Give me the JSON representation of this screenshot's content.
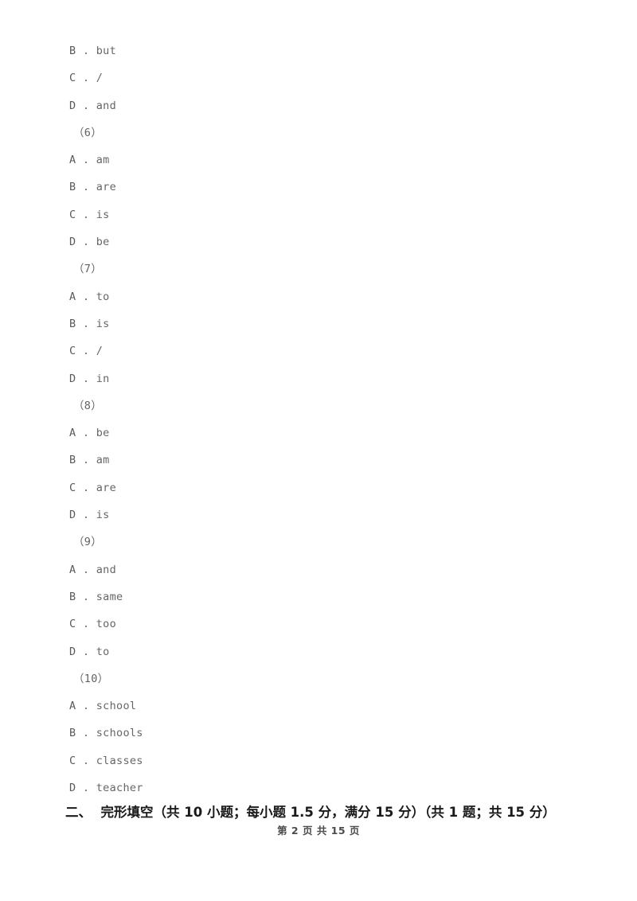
{
  "document": {
    "page_background": "#ffffff",
    "text_color": "#5f5f5f",
    "heading_color": "#1a1a1a"
  },
  "body_lines": [
    {
      "kind": "option",
      "letter": "B",
      "sep": " . ",
      "value": "but"
    },
    {
      "kind": "option",
      "letter": "C",
      "sep": " . ",
      "value": "/"
    },
    {
      "kind": "option",
      "letter": "D",
      "sep": " . ",
      "value": "and"
    },
    {
      "kind": "qnum",
      "text": "（6）"
    },
    {
      "kind": "option",
      "letter": "A",
      "sep": " . ",
      "value": "am"
    },
    {
      "kind": "option",
      "letter": "B",
      "sep": " . ",
      "value": "are"
    },
    {
      "kind": "option",
      "letter": "C",
      "sep": " . ",
      "value": "is"
    },
    {
      "kind": "option",
      "letter": "D",
      "sep": " . ",
      "value": "be"
    },
    {
      "kind": "qnum",
      "text": "（7）"
    },
    {
      "kind": "option",
      "letter": "A",
      "sep": " . ",
      "value": "to"
    },
    {
      "kind": "option",
      "letter": "B",
      "sep": " . ",
      "value": "is"
    },
    {
      "kind": "option",
      "letter": "C",
      "sep": " . ",
      "value": "/"
    },
    {
      "kind": "option",
      "letter": "D",
      "sep": " . ",
      "value": "in"
    },
    {
      "kind": "qnum",
      "text": "（8）"
    },
    {
      "kind": "option",
      "letter": "A",
      "sep": " . ",
      "value": "be"
    },
    {
      "kind": "option",
      "letter": "B",
      "sep": " . ",
      "value": "am"
    },
    {
      "kind": "option",
      "letter": "C",
      "sep": " . ",
      "value": "are"
    },
    {
      "kind": "option",
      "letter": "D",
      "sep": " . ",
      "value": "is"
    },
    {
      "kind": "qnum",
      "text": "（9）"
    },
    {
      "kind": "option",
      "letter": "A",
      "sep": " . ",
      "value": "and"
    },
    {
      "kind": "option",
      "letter": "B",
      "sep": " . ",
      "value": "same"
    },
    {
      "kind": "option",
      "letter": "C",
      "sep": " . ",
      "value": "too"
    },
    {
      "kind": "option",
      "letter": "D",
      "sep": " . ",
      "value": "to"
    },
    {
      "kind": "qnum",
      "text": "（10）"
    },
    {
      "kind": "option",
      "letter": "A",
      "sep": " . ",
      "value": "school"
    },
    {
      "kind": "option",
      "letter": "B",
      "sep": " . ",
      "value": "schools"
    },
    {
      "kind": "option",
      "letter": "C",
      "sep": " . ",
      "value": "classes"
    },
    {
      "kind": "option",
      "letter": "D",
      "sep": " . ",
      "value": "teacher"
    }
  ],
  "section_heading": {
    "number": "二、",
    "title": "完形填空（共 10 小题；每小题 1.5 分，满分 15 分）（共 1 题；共 15 分）",
    "full": "二、  完形填空（共 10 小题；每小题 1.5 分，满分 15 分）（共 1 题；共 15 分）"
  },
  "footer": {
    "text": "第 2 页 共 15 页",
    "current_page": "2",
    "total_pages": "15"
  }
}
